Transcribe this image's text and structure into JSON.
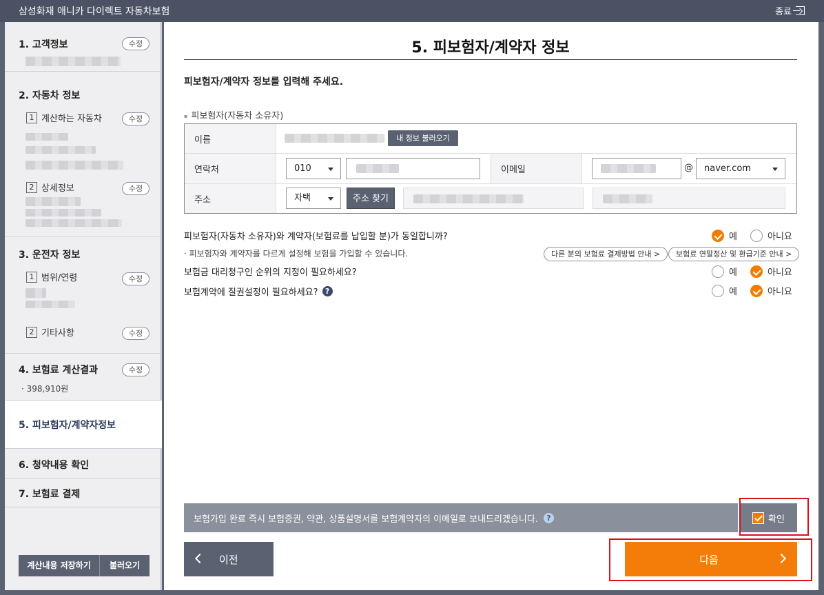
{
  "app": {
    "title": "삼성화재 애니카 다이렉트 자동차보험",
    "close_label": "종료"
  },
  "sidebar": {
    "steps": [
      {
        "label": "1. 고객정보",
        "edit": "수정"
      },
      {
        "label": "2. 자동차 정보",
        "subs": [
          {
            "num": "1",
            "label": "계산하는 자동차",
            "edit": "수정"
          },
          {
            "num": "2",
            "label": "상세정보",
            "edit": "수정"
          }
        ]
      },
      {
        "label": "3. 운전자 정보",
        "subs": [
          {
            "num": "1",
            "label": "범위/연령",
            "edit": "수정"
          },
          {
            "num": "2",
            "label": "기타사항",
            "edit": "수정"
          }
        ]
      },
      {
        "label": "4. 보험료 계산결과",
        "edit": "수정",
        "premium": "· 398,910원"
      },
      {
        "label": "5. 피보험자/계약자정보"
      },
      {
        "label": "6. 청약내용 확인"
      },
      {
        "label": "7. 보험료 결제"
      }
    ],
    "save_label": "계산내용 저장하기",
    "load_label": "불러오기"
  },
  "main": {
    "page_title": "5. 피보험자/계약자 정보",
    "intro": "피보험자/계약자 정보를 입력해 주세요.",
    "section_label": "피보험자(자동차 소유자)",
    "form": {
      "name_label": "이름",
      "load_my_info": "내 정보 불러오기",
      "phone_label": "연락처",
      "phone_prefix": "010",
      "email_label": "이메일",
      "email_at": "@",
      "email_domain": "naver.com",
      "address_label": "주소",
      "address_type": "자택",
      "address_search": "주소 찾기"
    },
    "questions": {
      "same_person": "피보험자(자동차 소유자)와 계약자(보험료를 납입할 분)가 동일합니까?",
      "same_person_note": "· 피보험자와 계약자를 다르게 설정해 보험을 가입할 수 있습니다.",
      "pill_payment": "다른 분의 보험료 결제방법 안내 >",
      "pill_tax": "보험료 연말정산 및 환급기준 안내 >",
      "proxy_claim": "보험금 대리청구인 순위의 지정이 필요하세요?",
      "pledge": "보험계약에 질권설정이 필요하세요?",
      "help_glyph": "?",
      "yes": "예",
      "no": "아니요"
    },
    "answers": {
      "same_person": "yes",
      "proxy_claim": "no",
      "pledge": "no"
    },
    "notice": "보험가입 완료 즉시 보험증권, 약관, 상품설명서를 보험계약자의 이메일로 보내드리겠습니다.",
    "confirm_label": "확인",
    "prev_label": "이전",
    "next_label": "다음"
  },
  "colors": {
    "accent": "#f47d0a",
    "dark": "#5a6272",
    "highlight": "#d9101e"
  }
}
